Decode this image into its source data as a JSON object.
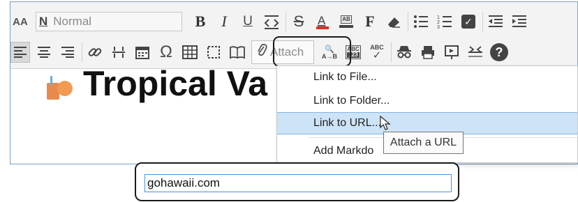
{
  "toolbar": {
    "font_size_label": "AA",
    "style_select": {
      "icon": "N",
      "value": "Normal"
    },
    "bold_label": "B",
    "italic_label": "I",
    "underline_label": "U",
    "attach_label": "Attach",
    "spell_label": "ABC",
    "spell_label2": "123",
    "abc_top": "ABC",
    "a_to_b": "A→B",
    "font_label": "F",
    "highlight_label": "AB"
  },
  "document": {
    "title_partial": "Tropical Va"
  },
  "attach_menu": {
    "items": [
      "Link to File...",
      "Link to Folder...",
      "Link to URL...",
      "Add Markdo"
    ]
  },
  "tooltip": {
    "text": "Attach a URL"
  },
  "url_input": {
    "value": "gohawaii.com"
  },
  "colors": {
    "menu_highlight": "#cde3f7",
    "input_border": "#4a90d9",
    "frame_border": "#7a9fc7"
  }
}
